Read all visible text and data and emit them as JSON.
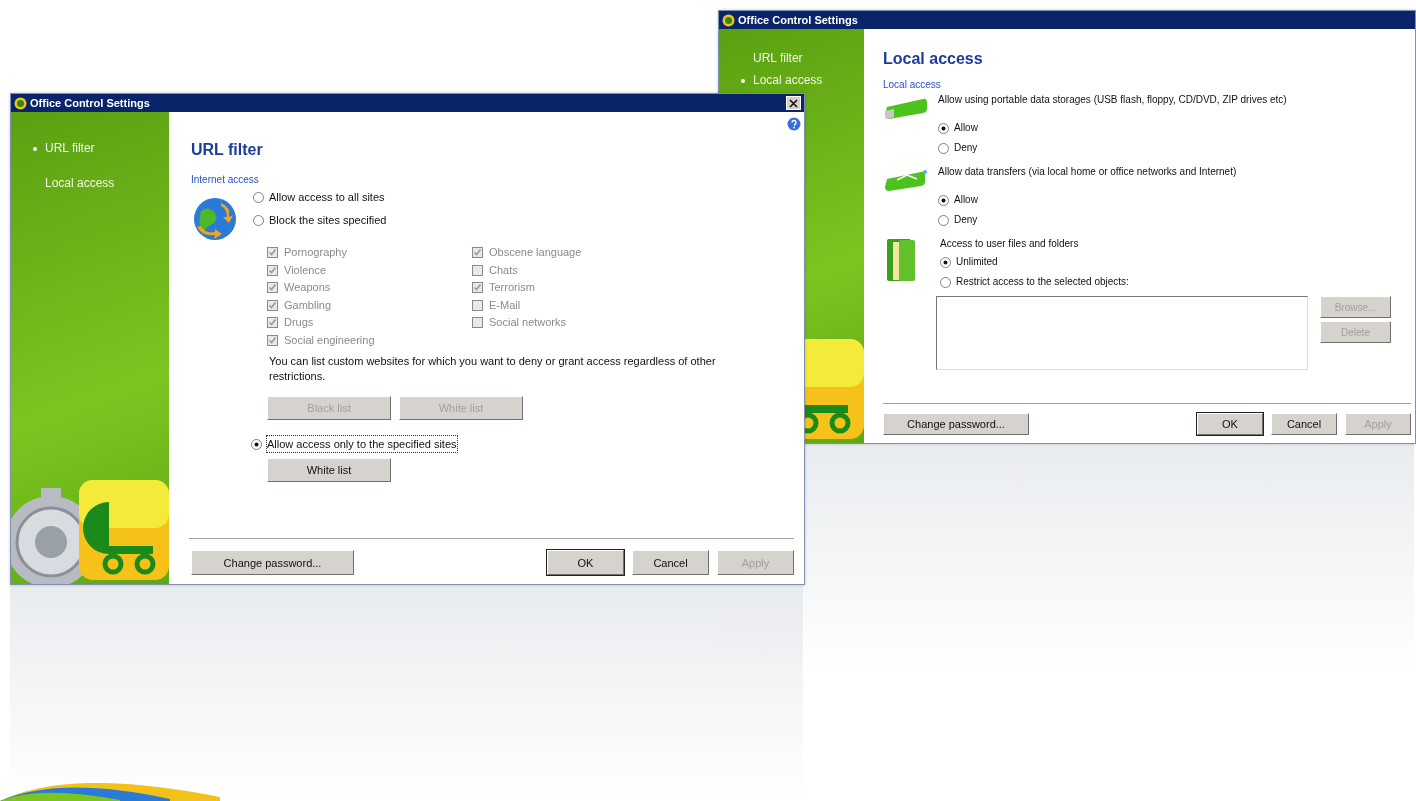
{
  "local_access_window": {
    "title": "Office Control Settings",
    "sidebar": [
      {
        "label": "URL filter",
        "selected": false
      },
      {
        "label": "Local access",
        "selected": true
      }
    ],
    "heading": "Local access",
    "section": "Local access",
    "groups": [
      {
        "kind": "storage",
        "label": "Allow using portable data storages (USB flash, floppy, CD/DVD, ZIP drives etc)",
        "options": [
          {
            "label": "Allow",
            "selected": true
          },
          {
            "label": "Deny",
            "selected": false
          }
        ]
      },
      {
        "kind": "network",
        "label": "Allow data transfers (via local home or office networks and Internet)",
        "options": [
          {
            "label": "Allow",
            "selected": true
          },
          {
            "label": "Deny",
            "selected": false
          }
        ]
      },
      {
        "kind": "folders",
        "label": "Access to user files and folders",
        "options": [
          {
            "label": "Unlimited",
            "selected": true
          },
          {
            "label": "Restrict access to the selected objects:",
            "selected": false
          }
        ]
      }
    ],
    "object_buttons": [
      {
        "label": "Browse...",
        "disabled": true
      },
      {
        "label": "Delete",
        "disabled": true
      }
    ],
    "footer_left": {
      "label": "Change password...",
      "disabled": false
    },
    "footer_buttons": [
      {
        "label": "OK",
        "disabled": false,
        "default": true
      },
      {
        "label": "Cancel",
        "disabled": false,
        "default": false
      },
      {
        "label": "Apply",
        "disabled": true,
        "default": false
      }
    ]
  },
  "url_filter_window": {
    "title": "Office Control Settings",
    "sidebar": [
      {
        "label": "URL filter",
        "selected": true
      },
      {
        "label": "Local access",
        "selected": false
      }
    ],
    "heading": "URL filter",
    "section": "Internet access",
    "access_modes": [
      {
        "label": "Allow access to all sites",
        "selected": false
      },
      {
        "label": "Block the sites specified",
        "selected": false
      },
      {
        "label": "Allow access only to the specified sites",
        "selected": true
      }
    ],
    "categories_disabled": true,
    "category_columns": [
      [
        {
          "label": "Pornography",
          "checked": true
        },
        {
          "label": "Violence",
          "checked": true
        },
        {
          "label": "Weapons",
          "checked": true
        },
        {
          "label": "Gambling",
          "checked": true
        },
        {
          "label": "Drugs",
          "checked": true
        },
        {
          "label": "Social engineering",
          "checked": true
        }
      ],
      [
        {
          "label": "Obscene language",
          "checked": true
        },
        {
          "label": "Chats",
          "checked": false
        },
        {
          "label": "Terrorism",
          "checked": true
        },
        {
          "label": "E-Mail",
          "checked": false
        },
        {
          "label": "Social networks",
          "checked": false
        }
      ]
    ],
    "custom_note": "You can list custom websites for which you want to deny or grant access regardless of other restrictions.",
    "list_buttons": [
      {
        "label": "Black list",
        "disabled": true
      },
      {
        "label": "White list",
        "disabled": true
      }
    ],
    "allowed_list_button": {
      "label": "White list",
      "disabled": false
    },
    "footer_left": {
      "label": "Change password...",
      "disabled": false
    },
    "footer_buttons": [
      {
        "label": "OK",
        "disabled": false,
        "default": true
      },
      {
        "label": "Cancel",
        "disabled": false,
        "default": false
      },
      {
        "label": "Apply",
        "disabled": true,
        "default": false
      }
    ]
  }
}
